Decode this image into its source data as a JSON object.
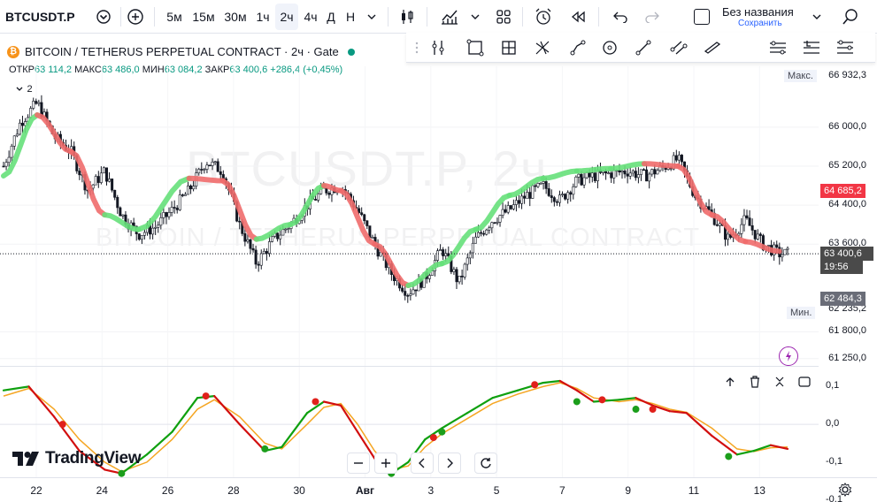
{
  "toolbar": {
    "symbol": "BTCUSDT.P",
    "intervals": [
      "5м",
      "15м",
      "30м",
      "1ч",
      "2ч",
      "4ч",
      "Д",
      "Н"
    ],
    "active_interval": "2ч",
    "layout_title": "Без названия",
    "layout_save": "Сохранить"
  },
  "legend": {
    "logo_letter": "₿",
    "title": "BITCOIN / TETHERUS PERPETUAL CONTRACT · 2ч · Gate",
    "ohlc": {
      "open_label": "ОТКР",
      "open": "63 114,2",
      "high_label": "МАКС",
      "high": "63 486,0",
      "low_label": "МИН",
      "low": "63 084,2",
      "close_label": "ЗАКР",
      "close": "63 400,6",
      "change": "+286,4 (+0,45%)"
    },
    "indicators_count": "2"
  },
  "watermark": {
    "line1": "BTCUSDT.P, 2ч",
    "line2": "BITCOIN / TETHERUS PERPETUAL CONTRACT"
  },
  "price_scale": {
    "ticks": [
      "66 000,0",
      "65 200,0",
      "64 400,0",
      "63 600,0",
      "61 800,0",
      "61 250,0"
    ],
    "max_label": "Макс.",
    "max_value": "66 932,3",
    "min_label": "Мин.",
    "min_value": "62 235,2",
    "ma_value": "64 685,2",
    "last_price": "63 400,6",
    "countdown": "19:56",
    "low_marker": "62 484,3"
  },
  "osc_scale": {
    "ticks": [
      "0,1",
      "0,0",
      "-0,1",
      "-0,1"
    ]
  },
  "time_axis": {
    "ticks": [
      "22",
      "24",
      "26",
      "28",
      "30",
      "Авг",
      "3",
      "5",
      "7",
      "9",
      "11",
      "13"
    ]
  },
  "branding": {
    "logo_text": "TradingView"
  },
  "colors": {
    "up": "#089981",
    "down": "#f23645",
    "ma_up": "#66e07a",
    "ma_down": "#f06b6b",
    "osc_fast_up": "#0fa00f",
    "osc_fast_down": "#d20f0f",
    "osc_slow": "#f5a623",
    "ma_label_bg": "#f23645",
    "last_label_bg": "#4a4a4a"
  },
  "chart_data": {
    "type": "candlestick",
    "title": "BITCOIN / TETHERUS PERPETUAL CONTRACT · 2ч · Gate",
    "ylim": [
      61100,
      67250
    ],
    "x_ticks": [
      "22",
      "24",
      "26",
      "28",
      "30",
      "Авг",
      "3",
      "5",
      "7",
      "9",
      "11",
      "13"
    ],
    "price_path": [
      [
        0,
        65200
      ],
      [
        2,
        66100
      ],
      [
        4,
        66500
      ],
      [
        6,
        65800
      ],
      [
        8,
        65500
      ],
      [
        10,
        64700
      ],
      [
        12,
        65100
      ],
      [
        14,
        64200
      ],
      [
        16,
        63800
      ],
      [
        18,
        63950
      ],
      [
        20,
        64300
      ],
      [
        22,
        64700
      ],
      [
        24,
        65300
      ],
      [
        26,
        65100
      ],
      [
        28,
        64000
      ],
      [
        30,
        63200
      ],
      [
        32,
        63700
      ],
      [
        34,
        64000
      ],
      [
        36,
        64400
      ],
      [
        38,
        64700
      ],
      [
        40,
        64800
      ],
      [
        42,
        64300
      ],
      [
        44,
        63600
      ],
      [
        46,
        63000
      ],
      [
        48,
        62600
      ],
      [
        50,
        62900
      ],
      [
        52,
        63500
      ],
      [
        54,
        62800
      ],
      [
        56,
        63700
      ],
      [
        58,
        64100
      ],
      [
        60,
        64300
      ],
      [
        62,
        64600
      ],
      [
        64,
        64800
      ],
      [
        66,
        64500
      ],
      [
        68,
        64900
      ],
      [
        70,
        65000
      ],
      [
        72,
        65050
      ],
      [
        74,
        65100
      ],
      [
        76,
        65000
      ],
      [
        78,
        65150
      ],
      [
        80,
        65350
      ],
      [
        82,
        64600
      ],
      [
        84,
        64200
      ],
      [
        86,
        63700
      ],
      [
        88,
        64100
      ],
      [
        90,
        63600
      ],
      [
        92,
        63400
      ]
    ],
    "ma_path": [
      [
        0,
        65000,
        "up"
      ],
      [
        4,
        66250,
        "up"
      ],
      [
        8,
        65500,
        "down"
      ],
      [
        12,
        64200,
        "down"
      ],
      [
        16,
        63900,
        "up"
      ],
      [
        22,
        64950,
        "up"
      ],
      [
        26,
        64900,
        "down"
      ],
      [
        30,
        63700,
        "down"
      ],
      [
        34,
        64000,
        "up"
      ],
      [
        38,
        64800,
        "up"
      ],
      [
        40,
        64700,
        "down"
      ],
      [
        44,
        63600,
        "down"
      ],
      [
        48,
        62750,
        "down"
      ],
      [
        52,
        63200,
        "up"
      ],
      [
        56,
        63900,
        "up"
      ],
      [
        60,
        64600,
        "up"
      ],
      [
        64,
        64950,
        "up"
      ],
      [
        68,
        65100,
        "up"
      ],
      [
        72,
        65150,
        "up"
      ],
      [
        76,
        65250,
        "up"
      ],
      [
        80,
        65200,
        "down"
      ],
      [
        84,
        64200,
        "down"
      ],
      [
        88,
        63650,
        "down"
      ],
      [
        92,
        63450,
        "down"
      ]
    ],
    "osc_ylim": [
      -0.14,
      0.15
    ],
    "osc_fast": [
      [
        0,
        0.09
      ],
      [
        3,
        0.1
      ],
      [
        6,
        0.02
      ],
      [
        9,
        -0.07
      ],
      [
        12,
        -0.12
      ],
      [
        14,
        -0.13
      ],
      [
        17,
        -0.08
      ],
      [
        20,
        -0.02
      ],
      [
        23,
        0.07
      ],
      [
        25,
        0.075
      ],
      [
        28,
        0.0
      ],
      [
        31,
        -0.07
      ],
      [
        33,
        -0.06
      ],
      [
        36,
        0.03
      ],
      [
        38,
        0.06
      ],
      [
        40,
        0.05
      ],
      [
        42,
        -0.02
      ],
      [
        44,
        -0.09
      ],
      [
        46,
        -0.13
      ],
      [
        48,
        -0.1
      ],
      [
        50,
        -0.04
      ],
      [
        52,
        -0.01
      ],
      [
        55,
        0.03
      ],
      [
        58,
        0.07
      ],
      [
        61,
        0.09
      ],
      [
        64,
        0.11
      ],
      [
        66,
        0.115
      ],
      [
        68,
        0.09
      ],
      [
        70,
        0.06
      ],
      [
        73,
        0.065
      ],
      [
        75,
        0.07
      ],
      [
        77,
        0.05
      ],
      [
        79,
        0.035
      ],
      [
        81,
        0.03
      ],
      [
        84,
        -0.03
      ],
      [
        87,
        -0.08
      ],
      [
        89,
        -0.07
      ],
      [
        91,
        -0.055
      ],
      [
        93,
        -0.065
      ]
    ],
    "osc_slow": [
      [
        0,
        0.075
      ],
      [
        3,
        0.095
      ],
      [
        6,
        0.04
      ],
      [
        9,
        -0.04
      ],
      [
        12,
        -0.1
      ],
      [
        14,
        -0.125
      ],
      [
        17,
        -0.1
      ],
      [
        20,
        -0.04
      ],
      [
        23,
        0.04
      ],
      [
        25,
        0.065
      ],
      [
        28,
        0.02
      ],
      [
        31,
        -0.05
      ],
      [
        33,
        -0.065
      ],
      [
        36,
        0.0
      ],
      [
        38,
        0.045
      ],
      [
        40,
        0.055
      ],
      [
        42,
        0.0
      ],
      [
        44,
        -0.07
      ],
      [
        46,
        -0.12
      ],
      [
        48,
        -0.11
      ],
      [
        50,
        -0.06
      ],
      [
        52,
        -0.025
      ],
      [
        55,
        0.015
      ],
      [
        58,
        0.055
      ],
      [
        61,
        0.08
      ],
      [
        64,
        0.1
      ],
      [
        66,
        0.11
      ],
      [
        68,
        0.095
      ],
      [
        70,
        0.07
      ],
      [
        73,
        0.06
      ],
      [
        75,
        0.065
      ],
      [
        77,
        0.055
      ],
      [
        79,
        0.04
      ],
      [
        81,
        0.032
      ],
      [
        84,
        -0.01
      ],
      [
        87,
        -0.065
      ],
      [
        89,
        -0.072
      ],
      [
        91,
        -0.062
      ],
      [
        93,
        -0.06
      ]
    ],
    "osc_crosses": [
      [
        7,
        0.0,
        "down"
      ],
      [
        14,
        -0.13,
        "up"
      ],
      [
        24,
        0.075,
        "down"
      ],
      [
        31,
        -0.065,
        "up"
      ],
      [
        37,
        0.06,
        "down"
      ],
      [
        46,
        -0.13,
        "up"
      ],
      [
        51,
        -0.035,
        "down"
      ],
      [
        52,
        -0.02,
        "up"
      ],
      [
        63,
        0.105,
        "down"
      ],
      [
        68,
        0.06,
        "up"
      ],
      [
        71,
        0.065,
        "down"
      ],
      [
        75,
        0.04,
        "up"
      ],
      [
        77,
        0.04,
        "down"
      ],
      [
        86,
        -0.085,
        "up"
      ]
    ]
  }
}
